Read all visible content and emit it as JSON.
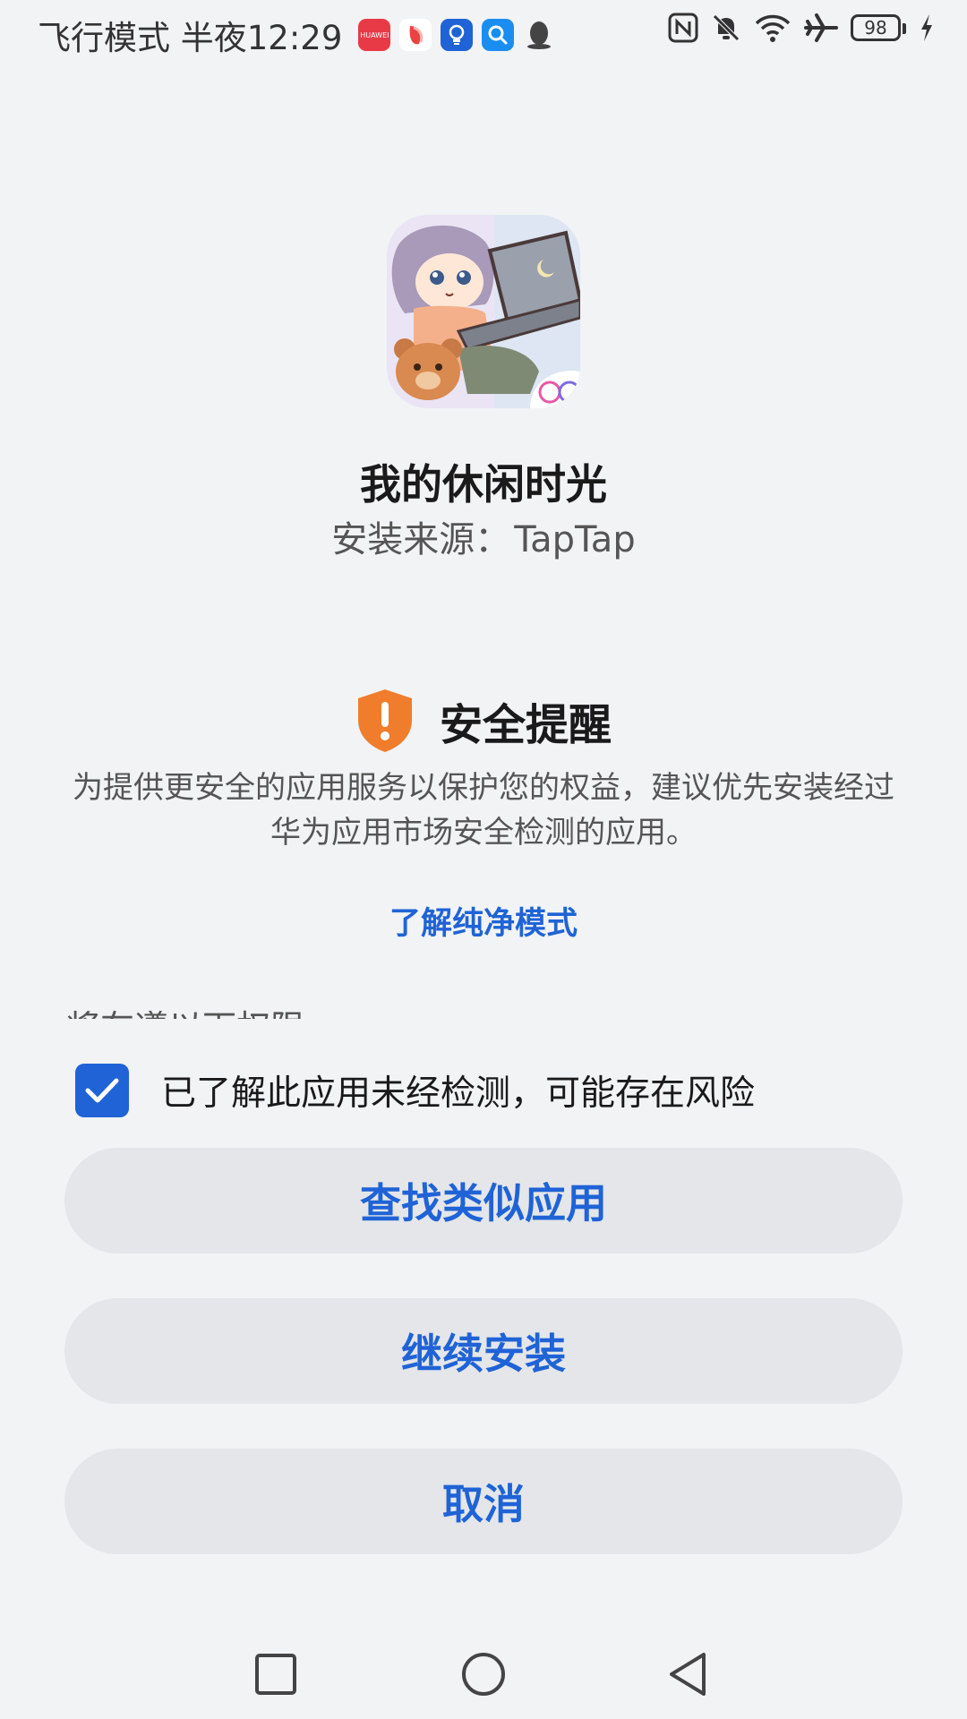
{
  "status_bar": {
    "text": "飞行模式 半夜12:29",
    "huawei_label": "HUAWEI",
    "battery_level": "98",
    "icons": [
      "huawei-appgallery-icon",
      "red-app-icon",
      "tips-bulb-icon",
      "search-app-icon",
      "qq-penguin-icon",
      "nfc-icon",
      "mute-bell-icon",
      "wifi-icon",
      "airplane-icon",
      "battery-icon",
      "charging-icon"
    ]
  },
  "app": {
    "name": "我的休闲时光",
    "source_label": "安装来源：",
    "source_value": "TapTap"
  },
  "security": {
    "title": "安全提醒",
    "body": "为提供更安全的应用服务以保护您的权益，建议优先安装经过华为应用市场安全检测的应用。",
    "learn_more": "了解纯净模式",
    "clipped_text": "将在遵以下权限"
  },
  "acknowledge": {
    "checked": true,
    "label": "已了解此应用未经检测，可能存在风险"
  },
  "buttons": {
    "find_similar": "查找类似应用",
    "continue_install": "继续安装",
    "cancel": "取消"
  },
  "colors": {
    "accent": "#1f63d6",
    "warning": "#ef7d2c",
    "background": "#f1f3f5",
    "button_bg": "#e4e6e9"
  }
}
